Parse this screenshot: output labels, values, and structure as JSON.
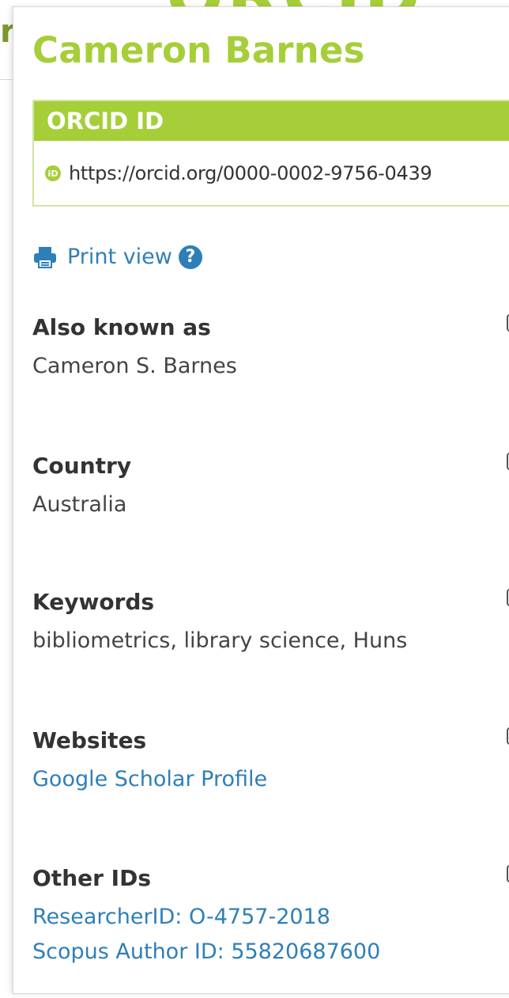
{
  "background": {
    "logo_text": "ORCID",
    "left_fragment": "r"
  },
  "profile": {
    "name": "Cameron Barnes",
    "orcid_box": {
      "title": "ORCID ID",
      "url": "https://orcid.org/0000-0002-9756-0439",
      "icon": "orcid-id-icon"
    },
    "print_view": {
      "label": "Print view",
      "icon": "printer-icon",
      "help_icon": "question-circle-icon"
    },
    "sections": {
      "also_known_as": {
        "title": "Also known as",
        "values": [
          "Cameron S. Barnes"
        ]
      },
      "country": {
        "title": "Country",
        "values": [
          "Australia"
        ]
      },
      "keywords": {
        "title": "Keywords",
        "values": [
          "bibliometrics, library science, Huns"
        ]
      },
      "websites": {
        "title": "Websites",
        "values": [
          "Google Scholar Profile"
        ]
      },
      "other_ids": {
        "title": "Other IDs",
        "values": [
          "ResearcherID: O-4757-2018",
          "Scopus Author ID: 55820687600"
        ]
      }
    },
    "colors": {
      "accent": "#a6ce39",
      "link": "#2e7fb8",
      "text": "#333333"
    }
  }
}
